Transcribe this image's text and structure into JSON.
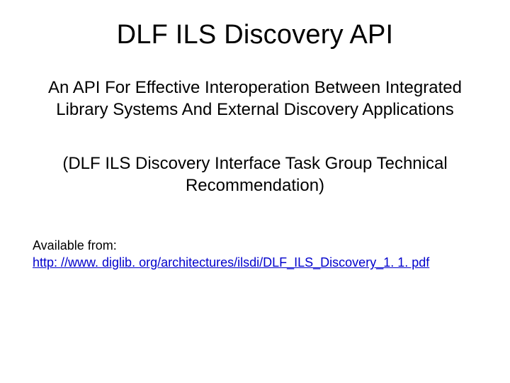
{
  "title": "DLF ILS Discovery API",
  "subtitle": "An API For Effective Interoperation Between Integrated Library Systems And External Discovery Applications",
  "paren": "(DLF ILS Discovery Interface Task Group Technical Recommendation)",
  "available_label": "Available from:",
  "link_text": "http: //www. diglib. org/architectures/ilsdi/DLF_ILS_Discovery_1. 1. pdf"
}
